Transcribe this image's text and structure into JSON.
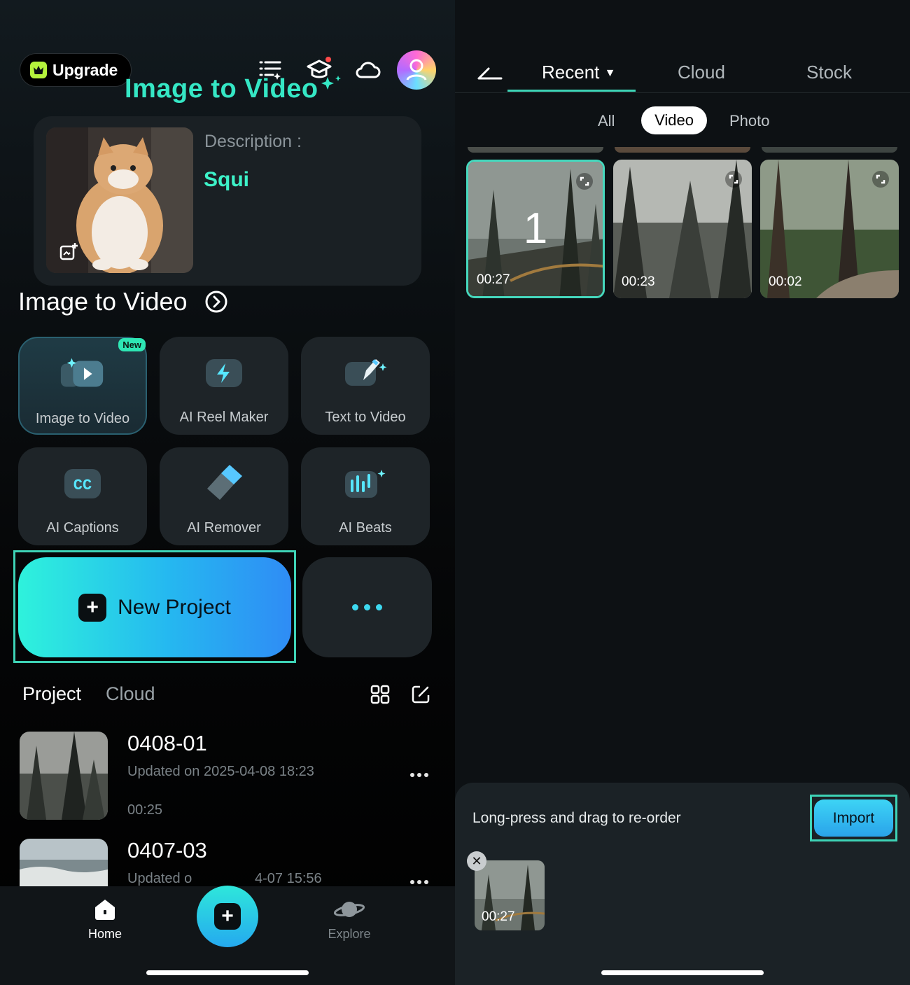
{
  "left": {
    "upgrade_label": "Upgrade",
    "brand_title": "Image to Video",
    "description_label": "Description :",
    "description_value": "Squi",
    "section_title": "Image to Video",
    "tools": [
      {
        "label": "Image to Video",
        "badge": "New"
      },
      {
        "label": "AI Reel Maker"
      },
      {
        "label": "Text to Video"
      },
      {
        "label": "AI Captions"
      },
      {
        "label": "AI Remover"
      },
      {
        "label": "AI Beats"
      }
    ],
    "new_project_label": "New Project",
    "tabs": {
      "project": "Project",
      "cloud": "Cloud"
    },
    "projects": [
      {
        "title": "0408-01",
        "updated": "Updated on 2025-04-08 18:23",
        "duration": "00:25"
      },
      {
        "title": "0407-03",
        "updated_a": "Updated o",
        "updated_b": "4-07 15:56"
      }
    ],
    "nav": {
      "home": "Home",
      "explore": "Explore"
    },
    "cc_text": "CC"
  },
  "right": {
    "tabs": [
      "Recent",
      "Cloud",
      "Stock"
    ],
    "filters": [
      "All",
      "Video",
      "Photo"
    ],
    "media": [
      {
        "duration": "00:27",
        "selected_index": "1"
      },
      {
        "duration": "00:23"
      },
      {
        "duration": "00:02"
      }
    ],
    "hint": "Long-press and drag to re-order",
    "import_label": "Import",
    "tray_duration": "00:27",
    "close_symbol": "✕"
  },
  "colors": {
    "accent": "#3ed3b6",
    "brand_teal": "#35e7c5",
    "dark_bg": "#0d1114"
  }
}
